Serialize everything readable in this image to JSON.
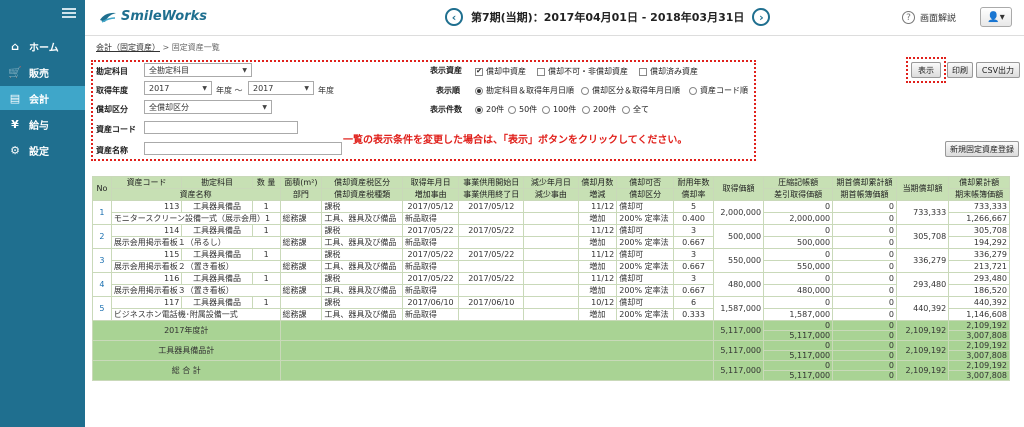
{
  "sidebar": {
    "items": [
      {
        "label": "ホーム",
        "icon": "home-icon",
        "glyph": "⌂"
      },
      {
        "label": "販売",
        "icon": "cart-icon",
        "glyph": "🛒"
      },
      {
        "label": "会計",
        "icon": "ledger-icon",
        "glyph": "▤"
      },
      {
        "label": "給与",
        "icon": "money-bag-icon",
        "glyph": "¥"
      },
      {
        "label": "設定",
        "icon": "gear-icon",
        "glyph": "⚙"
      }
    ],
    "active_index": 2
  },
  "header": {
    "logo_text": "SmileWorks",
    "period_text": "第7期(当期)：2017年04月01日 - 2018年03月31日",
    "prev_glyph": "‹",
    "next_glyph": "›",
    "help_label": "画面解説",
    "user_glyph": "👤▾"
  },
  "breadcrumb": {
    "link": "会計（固定資産）",
    "sep": ">",
    "current": "固定資産一覧"
  },
  "filters": {
    "account_label": "勘定科目",
    "account_value": "全勘定科目",
    "year_label": "取得年度",
    "year_from": "2017",
    "year_unit_from": "年度 〜",
    "year_to": "2017",
    "year_unit_to": "年度",
    "dept_label": "償却区分",
    "dept_value": "全償却区分",
    "code_label": "資産コード",
    "name_label": "資産名称",
    "display_assets_label": "表示資産",
    "display_assets_options": [
      {
        "label": "償却中資産",
        "checked": true
      },
      {
        "label": "償却不可・非償却資産",
        "checked": false
      },
      {
        "label": "償却済み資産",
        "checked": false
      }
    ],
    "order_label": "表示順",
    "order_options": [
      {
        "label": "勘定科目＆取得年月日順",
        "checked": true
      },
      {
        "label": "償却区分＆取得年月日順",
        "checked": false
      },
      {
        "label": "資産コード順",
        "checked": false
      }
    ],
    "count_label": "表示件数",
    "count_options": [
      {
        "label": "20件",
        "checked": true
      },
      {
        "label": "50件",
        "checked": false
      },
      {
        "label": "100件",
        "checked": false
      },
      {
        "label": "200件",
        "checked": false
      },
      {
        "label": "全て",
        "checked": false
      }
    ]
  },
  "notice": "一覧の表示条件を変更した場合は、「表示」ボタンをクリックしてください。",
  "buttons": {
    "show": "表示",
    "print": "印刷",
    "csv": "CSV出力",
    "new": "新規固定資産登録"
  },
  "table": {
    "headers_top": [
      "No",
      "資産コード",
      "勘定科目",
      "数 量",
      "面積(m²)",
      "償却資産税区分",
      "取得年月日",
      "事業供用開始日",
      "減少年月日",
      "償却月数",
      "償却可否",
      "耐用年数",
      "取得価額",
      "圧縮記帳額",
      "期首償却累計額",
      "当期償却額",
      "償却累計額"
    ],
    "headers_bottom": [
      "資産名称",
      "部門",
      "償却資産税種類",
      "増加事由",
      "事業供用終了日",
      "減少事由",
      "増減",
      "償却区分",
      "償却率",
      "差引取得価額",
      "期首帳簿価額",
      "期末帳簿価額"
    ],
    "rows": [
      {
        "no": "1",
        "code": "113",
        "account": "工具器具備品",
        "qty": "1",
        "tax_class": "課税",
        "acq_date": "2017/05/12",
        "start_date": "2017/05/12",
        "dec_date": "",
        "months": "11/12",
        "dep_ok": "償却可",
        "life": "5",
        "cost": "2,000,000",
        "comp": "0",
        "open_acc": "0",
        "cur_dep": "733,333",
        "acc_dep": "733,333",
        "name": "モニタースクリーン設備一式（展示会用）1",
        "dept": "総務課",
        "tax_kind": "工具、器具及び備品",
        "reason": "新品取得",
        "end_date": "",
        "dec_reason": "",
        "inc": "増加",
        "method": "200% 定率法",
        "rate": "0.400",
        "net_cost": "2,000,000",
        "open_book": "0",
        "close_book": "1,266,667"
      },
      {
        "no": "2",
        "code": "114",
        "account": "工具器具備品",
        "qty": "1",
        "tax_class": "課税",
        "acq_date": "2017/05/22",
        "start_date": "2017/05/22",
        "dec_date": "",
        "months": "11/12",
        "dep_ok": "償却可",
        "life": "3",
        "cost": "500,000",
        "comp": "0",
        "open_acc": "0",
        "cur_dep": "305,708",
        "acc_dep": "305,708",
        "name": "展示会用掲示看板１（吊るし）",
        "dept": "総務課",
        "tax_kind": "工具、器具及び備品",
        "reason": "新品取得",
        "end_date": "",
        "dec_reason": "",
        "inc": "増加",
        "method": "200% 定率法",
        "rate": "0.667",
        "net_cost": "500,000",
        "open_book": "0",
        "close_book": "194,292"
      },
      {
        "no": "3",
        "code": "115",
        "account": "工具器具備品",
        "qty": "1",
        "tax_class": "課税",
        "acq_date": "2017/05/22",
        "start_date": "2017/05/22",
        "dec_date": "",
        "months": "11/12",
        "dep_ok": "償却可",
        "life": "3",
        "cost": "550,000",
        "comp": "0",
        "open_acc": "0",
        "cur_dep": "336,279",
        "acc_dep": "336,279",
        "name": "展示会用掲示看板２（置き看板）",
        "dept": "総務課",
        "tax_kind": "工具、器具及び備品",
        "reason": "新品取得",
        "end_date": "",
        "dec_reason": "",
        "inc": "増加",
        "method": "200% 定率法",
        "rate": "0.667",
        "net_cost": "550,000",
        "open_book": "0",
        "close_book": "213,721"
      },
      {
        "no": "4",
        "code": "116",
        "account": "工具器具備品",
        "qty": "1",
        "tax_class": "課税",
        "acq_date": "2017/05/22",
        "start_date": "2017/05/22",
        "dec_date": "",
        "months": "11/12",
        "dep_ok": "償却可",
        "life": "3",
        "cost": "480,000",
        "comp": "0",
        "open_acc": "0",
        "cur_dep": "293,480",
        "acc_dep": "293,480",
        "name": "展示会用掲示看板３（置き看板）",
        "dept": "総務課",
        "tax_kind": "工具、器具及び備品",
        "reason": "新品取得",
        "end_date": "",
        "dec_reason": "",
        "inc": "増加",
        "method": "200% 定率法",
        "rate": "0.667",
        "net_cost": "480,000",
        "open_book": "0",
        "close_book": "186,520"
      },
      {
        "no": "5",
        "code": "117",
        "account": "工具器具備品",
        "qty": "1",
        "tax_class": "課税",
        "acq_date": "2017/06/10",
        "start_date": "2017/06/10",
        "dec_date": "",
        "months": "10/12",
        "dep_ok": "償却可",
        "life": "6",
        "cost": "1,587,000",
        "comp": "0",
        "open_acc": "0",
        "cur_dep": "440,392",
        "acc_dep": "440,392",
        "name": "ビジネスホン電話機･附属設備一式",
        "dept": "総務課",
        "tax_kind": "工具、器具及び備品",
        "reason": "新品取得",
        "end_date": "",
        "dec_reason": "",
        "inc": "増加",
        "method": "200% 定率法",
        "rate": "0.333",
        "net_cost": "1,587,000",
        "open_book": "0",
        "close_book": "1,146,608"
      }
    ],
    "totals": [
      {
        "label": "2017年度計",
        "cost": "5,117,000",
        "comp": "0",
        "net_cost": "5,117,000",
        "open_acc": "0",
        "open_book": "0",
        "cur_dep": "2,109,192",
        "acc_dep": "2,109,192",
        "close_book": "3,007,808"
      },
      {
        "label": "工具器具備品計",
        "cost": "5,117,000",
        "comp": "0",
        "net_cost": "5,117,000",
        "open_acc": "0",
        "open_book": "0",
        "cur_dep": "2,109,192",
        "acc_dep": "2,109,192",
        "close_book": "3,007,808"
      },
      {
        "label": "総 合 計",
        "cost": "5,117,000",
        "comp": "0",
        "net_cost": "5,117,000",
        "open_acc": "0",
        "open_book": "0",
        "cur_dep": "2,109,192",
        "acc_dep": "2,109,192",
        "close_book": "3,007,808"
      }
    ]
  },
  "colors": {
    "sidebar": "#1f6f8f",
    "sidebar_active": "#3fa6c9",
    "table_header": "#c7e0b4",
    "table_total": "#a9d394",
    "notice_red": "#e0201b"
  }
}
